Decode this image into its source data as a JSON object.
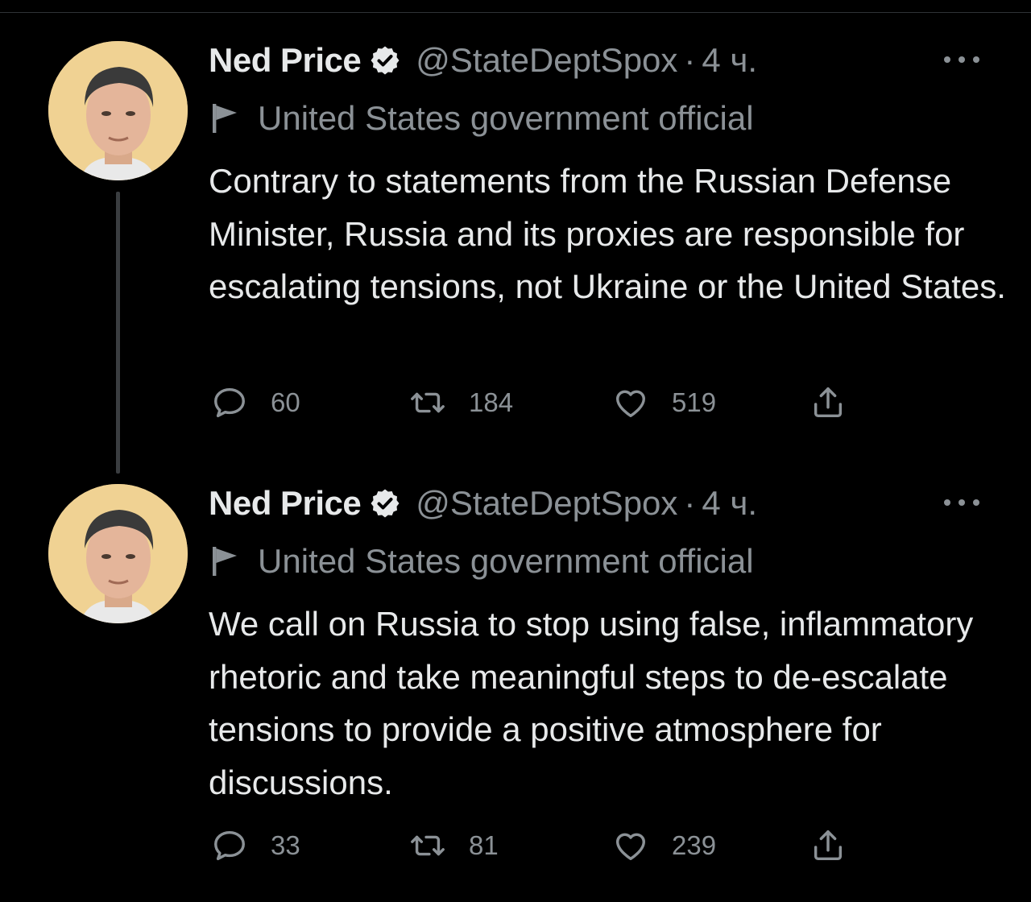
{
  "tweets": [
    {
      "author_name": "Ned Price",
      "handle": "@StateDeptSpox",
      "separator": "·",
      "time": "4 ч.",
      "account_label": "United States government official",
      "text": "Contrary to statements from the Russian Defense Minister, Russia and its proxies are responsible for escalating tensions, not Ukraine or the United States.",
      "replies": "60",
      "retweets": "184",
      "likes": "519"
    },
    {
      "author_name": "Ned Price",
      "handle": "@StateDeptSpox",
      "separator": "·",
      "time": "4 ч.",
      "account_label": "United States government official",
      "text": "We call on Russia to stop using false, inflammatory rhetoric and take meaningful steps to de-escalate tensions to provide a positive atmosphere for discussions.",
      "replies": "33",
      "retweets": "81",
      "likes": "239"
    }
  ],
  "icons": {
    "verified": "verified-badge-icon",
    "more": "more-icon",
    "flag": "flag-icon",
    "reply": "reply-icon",
    "retweet": "retweet-icon",
    "like": "like-icon",
    "share": "share-icon"
  },
  "colors": {
    "background": "#000000",
    "primary_text": "#e7e9ea",
    "secondary_text": "#8b9196",
    "avatar_background": "#f0d293"
  }
}
